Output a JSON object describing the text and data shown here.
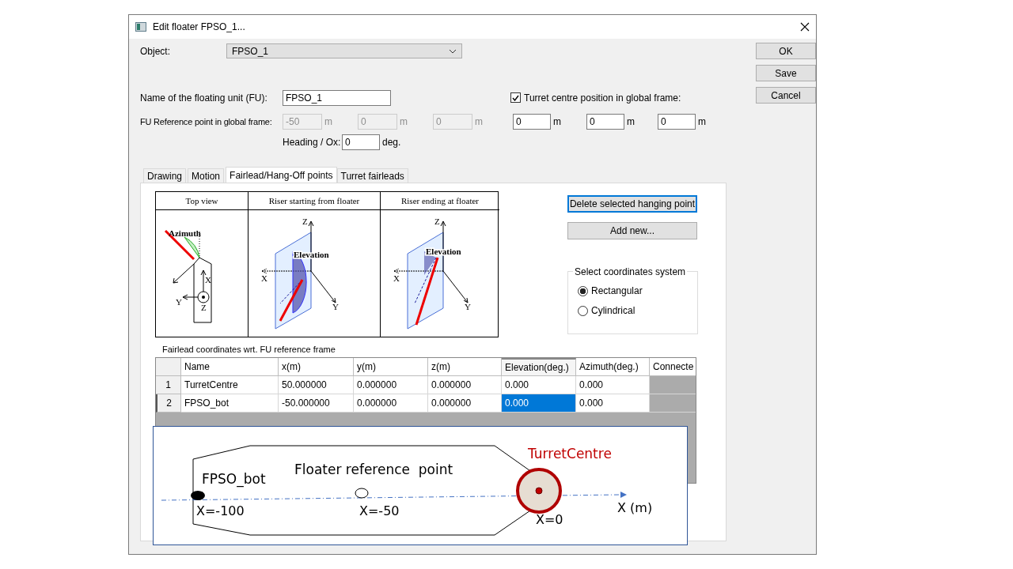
{
  "window": {
    "title": "Edit floater FPSO_1..."
  },
  "buttons": [
    "OK",
    "Save",
    "Cancel"
  ],
  "object": {
    "label": "Object:",
    "value": "FPSO_1"
  },
  "name_field": {
    "label": "Name of the floating unit (FU):",
    "value": "FPSO_1"
  },
  "turret_checkbox": {
    "label": "Turret centre position in global frame:",
    "checked": true
  },
  "reference_point": {
    "label": "FU Reference point in global frame:",
    "disabled": true,
    "fields": [
      {
        "value": "-50",
        "unit": "m"
      },
      {
        "value": "0",
        "unit": "m"
      },
      {
        "value": "0",
        "unit": "m"
      }
    ]
  },
  "turret_position": {
    "disabled": false,
    "fields": [
      {
        "value": "0",
        "unit": "m"
      },
      {
        "value": "0",
        "unit": "m"
      },
      {
        "value": "0",
        "unit": "m"
      }
    ]
  },
  "heading": {
    "label": "Heading / Ox:",
    "value": "0",
    "unit": "deg."
  },
  "tabs": [
    {
      "label": "Drawing",
      "selected": false
    },
    {
      "label": "Motion",
      "selected": false
    },
    {
      "label": "Fairlead/Hang-Off points",
      "selected": true
    },
    {
      "label": "Turret fairleads",
      "selected": false
    }
  ],
  "figure": {
    "panels": [
      {
        "kind": "top",
        "title": "Top view",
        "angle": "Azimuth",
        "axes": [
          "X",
          "Y",
          "Z"
        ]
      },
      {
        "kind": "start",
        "title": "Riser starting from floater",
        "angle": "Elevation",
        "axes": [
          "Z",
          "X",
          "Y"
        ]
      },
      {
        "kind": "end",
        "title": "Riser ending at floater",
        "angle": "Elevation",
        "axes": [
          "Z",
          "X",
          "Y"
        ]
      }
    ]
  },
  "actions": [
    {
      "label": "Delete selected hanging point",
      "focused": true
    },
    {
      "label": "Add new...",
      "focused": false
    }
  ],
  "coordinates": {
    "title": "Select coordinates system",
    "options": [
      {
        "label": "Rectangular",
        "selected": true
      },
      {
        "label": "Cylindrical",
        "selected": false
      }
    ]
  },
  "table": {
    "caption": "Fairlead coordinates wrt. FU reference frame",
    "columns": [
      {
        "label": "Name",
        "focused": false
      },
      {
        "label": "x(m)",
        "focused": false
      },
      {
        "label": "y(m)",
        "focused": false
      },
      {
        "label": "z(m)",
        "focused": false
      },
      {
        "label": "Elevation(deg.)",
        "focused": true
      },
      {
        "label": "Azimuth(deg.)",
        "focused": false
      },
      {
        "label": "Connecte",
        "focused": false
      }
    ],
    "rows": [
      {
        "index": "1",
        "current": false,
        "cells": [
          {
            "text": "TurretCentre",
            "selected": false
          },
          {
            "text": "50.000000",
            "selected": false
          },
          {
            "text": "0.000000",
            "selected": false
          },
          {
            "text": "0.000000",
            "selected": false
          },
          {
            "text": "0.000",
            "selected": false
          },
          {
            "text": "0.000",
            "selected": false
          }
        ]
      },
      {
        "index": "2",
        "current": true,
        "cells": [
          {
            "text": "FPSO_bot",
            "selected": false
          },
          {
            "text": "-50.000000",
            "selected": false
          },
          {
            "text": "0.000000",
            "selected": false
          },
          {
            "text": "0.000000",
            "selected": false
          },
          {
            "text": "0.000",
            "selected": true
          },
          {
            "text": "0.000",
            "selected": false
          }
        ]
      }
    ]
  },
  "overlay": {
    "bottom_label": "FPSO_bot",
    "reference_label": "Floater reference  point",
    "turret_label": "TurretCentre",
    "bottom_x": "X=-100",
    "reference_x": "X=-50",
    "turret_x": "X=0",
    "axis_label": "X (m)"
  }
}
